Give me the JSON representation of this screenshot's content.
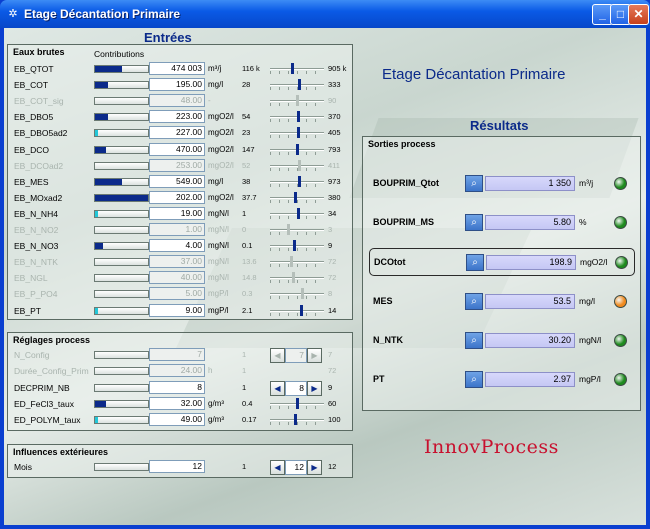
{
  "window": {
    "title": "Etage Décantation Primaire"
  },
  "entrees_title": "Entrées",
  "header_title": "Etage Décantation Primaire",
  "resultats_title": "Résultats",
  "eaux": {
    "title": "Eaux brutes",
    "contrib": "Contributions",
    "rows": [
      {
        "label": "EB_QTOT",
        "value": "474 003",
        "unit": "m³/j",
        "min": "116 k",
        "max": "905 k",
        "fill": 0.5,
        "cyan": false,
        "pos": 0.42,
        "enabled": true
      },
      {
        "label": "EB_COT",
        "value": "195.00",
        "unit": "mg/l",
        "min": "28",
        "max": "333",
        "fill": 0.25,
        "cyan": false,
        "pos": 0.54,
        "enabled": true
      },
      {
        "label": "EB_COT_sig",
        "value": "48.00",
        "unit": "-",
        "min": "",
        "max": "90",
        "fill": 0,
        "cyan": false,
        "pos": 0.5,
        "enabled": false
      },
      {
        "label": "EB_DBO5",
        "value": "223.00",
        "unit": "mgO2/l",
        "min": "54",
        "max": "370",
        "fill": 0.25,
        "cyan": false,
        "pos": 0.52,
        "enabled": true
      },
      {
        "label": "EB_DBO5ad2",
        "value": "227.00",
        "unit": "mgO2/l",
        "min": "23",
        "max": "405",
        "fill": 0.05,
        "cyan": true,
        "pos": 0.53,
        "enabled": true
      },
      {
        "label": "EB_DCO",
        "value": "470.00",
        "unit": "mgO2/l",
        "min": "147",
        "max": "793",
        "fill": 0.2,
        "cyan": false,
        "pos": 0.5,
        "enabled": true
      },
      {
        "label": "EB_DCOad2",
        "value": "253.00",
        "unit": "mgO2/l",
        "min": "52",
        "max": "411",
        "fill": 0,
        "cyan": false,
        "pos": 0.55,
        "enabled": false
      },
      {
        "label": "EB_MES",
        "value": "549.00",
        "unit": "mg/l",
        "min": "38",
        "max": "973",
        "fill": 0.5,
        "cyan": false,
        "pos": 0.55,
        "enabled": true
      },
      {
        "label": "EB_MOxad2",
        "value": "202.00",
        "unit": "mgO2/l",
        "min": "37.7",
        "max": "380",
        "fill": 1.0,
        "cyan": false,
        "pos": 0.48,
        "enabled": true
      },
      {
        "label": "EB_N_NH4",
        "value": "19.00",
        "unit": "mgN/l",
        "min": "1",
        "max": "34",
        "fill": 0.05,
        "cyan": true,
        "pos": 0.52,
        "enabled": true
      },
      {
        "label": "EB_N_NO2",
        "value": "1.00",
        "unit": "mgN/l",
        "min": "0",
        "max": "3",
        "fill": 0,
        "cyan": false,
        "pos": 0.33,
        "enabled": false
      },
      {
        "label": "EB_N_NO3",
        "value": "4.00",
        "unit": "mgN/l",
        "min": "0.1",
        "max": "9",
        "fill": 0.15,
        "cyan": false,
        "pos": 0.45,
        "enabled": true
      },
      {
        "label": "EB_N_NTK",
        "value": "37.00",
        "unit": "mgN/l",
        "min": "13.6",
        "max": "72",
        "fill": 0,
        "cyan": false,
        "pos": 0.4,
        "enabled": false
      },
      {
        "label": "EB_NGL",
        "value": "40.00",
        "unit": "mgN/l",
        "min": "14.8",
        "max": "72",
        "fill": 0,
        "cyan": false,
        "pos": 0.44,
        "enabled": false
      },
      {
        "label": "EB_P_PO4",
        "value": "5.00",
        "unit": "mgP/l",
        "min": "0.3",
        "max": "8",
        "fill": 0,
        "cyan": false,
        "pos": 0.6,
        "enabled": false
      },
      {
        "label": "EB_PT",
        "value": "9.00",
        "unit": "mgP/l",
        "min": "2.1",
        "max": "14",
        "fill": 0.05,
        "cyan": true,
        "pos": 0.58,
        "enabled": true
      }
    ]
  },
  "reglages": {
    "title": "Réglages process",
    "rows": [
      {
        "label": "N_Config",
        "value": "7",
        "unit": "",
        "min": "1",
        "max": "7",
        "fill": 0,
        "cyan": false,
        "control": "spin",
        "spin": "7",
        "enabled": false
      },
      {
        "label": "Durée_Config_Prim",
        "value": "24.00",
        "unit": "h",
        "min": "1",
        "max": "72",
        "fill": 0,
        "cyan": false,
        "control": "none",
        "enabled": false
      },
      {
        "label": "DECPRIM_NB",
        "value": "8",
        "unit": "",
        "min": "1",
        "max": "9",
        "fill": 0,
        "cyan": false,
        "control": "spin",
        "spin": "8",
        "enabled": true
      },
      {
        "label": "ED_FeCl3_taux",
        "value": "32.00",
        "unit": "g/m³",
        "min": "0.4",
        "max": "60",
        "fill": 0.2,
        "cyan": false,
        "control": "slider",
        "pos": 0.5,
        "enabled": true
      },
      {
        "label": "ED_POLYM_taux",
        "value": "49.00",
        "unit": "g/m³",
        "min": "0.17",
        "max": "100",
        "fill": 0.05,
        "cyan": true,
        "control": "slider",
        "pos": 0.48,
        "enabled": true
      }
    ]
  },
  "influences": {
    "title": "Influences extérieures",
    "rows": [
      {
        "label": "Mois",
        "value": "12",
        "unit": "",
        "min": "1",
        "max": "12",
        "fill": 0,
        "cyan": false,
        "control": "spin",
        "spin": "12",
        "enabled": true
      }
    ]
  },
  "sorties": {
    "title": "Sorties process",
    "rows": [
      {
        "label": "BOUPRIM_Qtot",
        "value": "1 350",
        "unit": "m³/j",
        "status": "#1e8a1e",
        "highlight": false
      },
      {
        "label": "BOUPRIM_MS",
        "value": "5.80",
        "unit": "%",
        "status": "#1e8a1e",
        "highlight": false
      },
      {
        "label": "DCOtot",
        "value": "198.9",
        "unit": "mgO2/l",
        "status": "#1e8a1e",
        "highlight": true
      },
      {
        "label": "MES",
        "value": "53.5",
        "unit": "mg/l",
        "status": "#f08a1e",
        "highlight": false
      },
      {
        "label": "N_NTK",
        "value": "30.20",
        "unit": "mgN/l",
        "status": "#1e8a1e",
        "highlight": false
      },
      {
        "label": "PT",
        "value": "2.97",
        "unit": "mgP/l",
        "status": "#1e8a1e",
        "highlight": false
      }
    ]
  },
  "brand": "InnovProcess"
}
